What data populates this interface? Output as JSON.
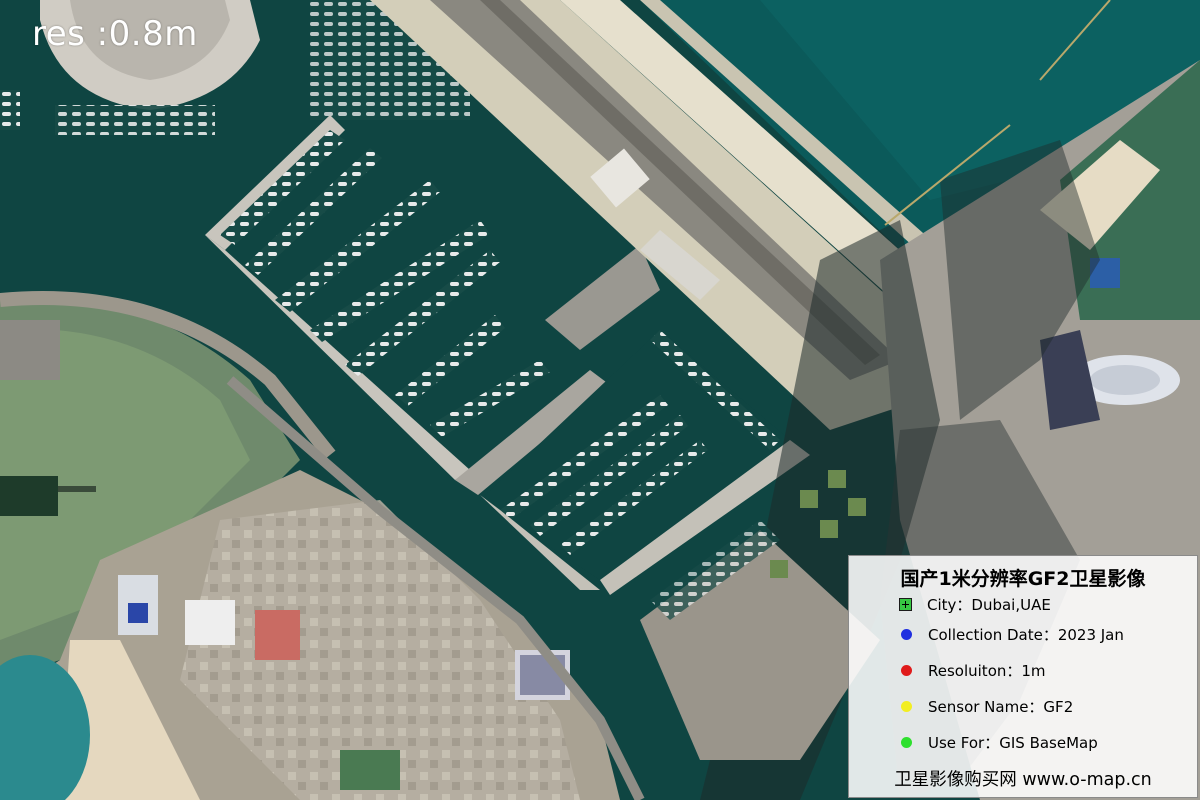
{
  "image": {
    "resolution_label": "res :0.8m"
  },
  "legend": {
    "title": "国产1米分辨率GF2卫星影像",
    "items": [
      {
        "symbol": "green-square-cross",
        "color": "#37c843",
        "text": "City：Dubai,UAE"
      },
      {
        "symbol": "dot",
        "color": "#1f2fe0",
        "text": "Collection Date：2023 Jan"
      },
      {
        "symbol": "dot",
        "color": "#e01b1b",
        "text": "Resoluiton：1m"
      },
      {
        "symbol": "dot",
        "color": "#f2ee22",
        "text": "Sensor Name：GF2"
      },
      {
        "symbol": "dot",
        "color": "#2ee02e",
        "text": "Use For：GIS BaseMap"
      }
    ],
    "footer": "卫星影像购买网 www.o-map.cn"
  }
}
